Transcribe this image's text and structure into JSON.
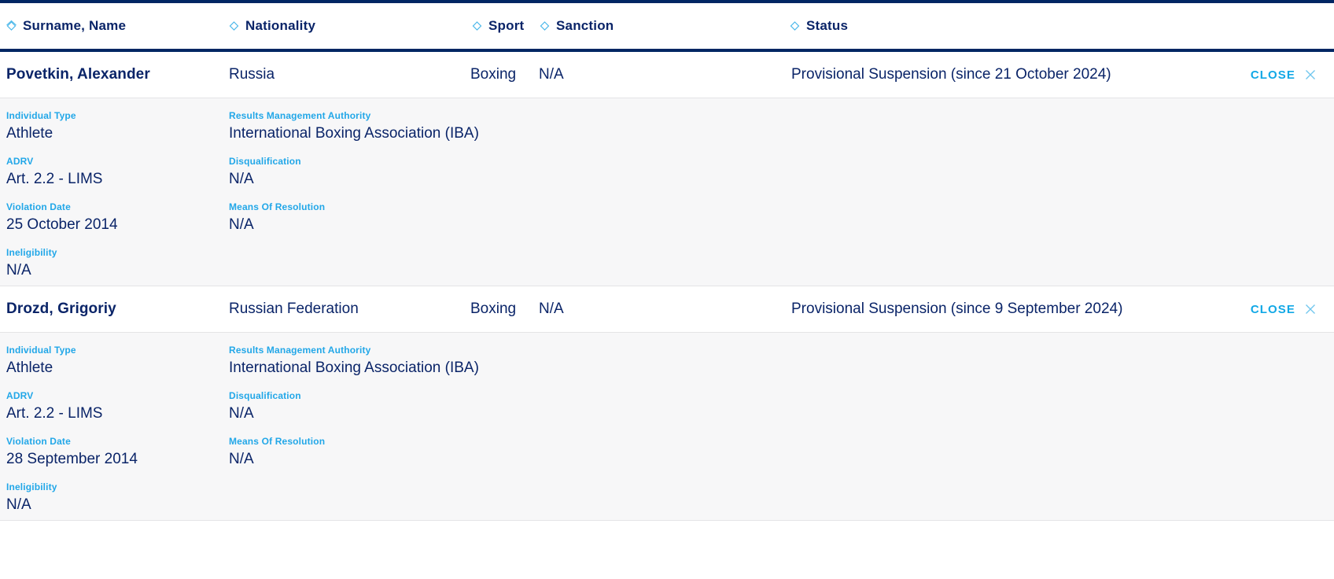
{
  "table": {
    "columns": [
      {
        "label": "Surname, Name",
        "sort_icon": "sort-diamond-icon"
      },
      {
        "label": "Nationality",
        "sort_icon": "sort-diamond-icon"
      },
      {
        "label": "Sport",
        "sort_icon": "sort-diamond-icon"
      },
      {
        "label": "Sanction",
        "sort_icon": "sort-diamond-icon"
      },
      {
        "label": "Status",
        "sort_icon": "sort-diamond-icon"
      }
    ],
    "close_label": "CLOSE",
    "close_icon": "close-x-icon",
    "rows": [
      {
        "name": "Povetkin, Alexander",
        "nationality": "Russia",
        "sport": "Boxing",
        "sanction": "N/A",
        "status": "Provisional Suspension (since 21 October 2024)",
        "details": {
          "individual_type": {
            "label": "Individual Type",
            "value": "Athlete"
          },
          "results_management_authority": {
            "label": "Results Management Authority",
            "value": "International Boxing Association (IBA)"
          },
          "adrv": {
            "label": "ADRV",
            "value": "Art. 2.2 - LIMS"
          },
          "disqualification": {
            "label": "Disqualification",
            "value": "N/A"
          },
          "violation_date": {
            "label": "Violation Date",
            "value": "25 October 2014"
          },
          "means_of_resolution": {
            "label": "Means Of Resolution",
            "value": "N/A"
          },
          "ineligibility": {
            "label": "Ineligibility",
            "value": "N/A"
          }
        }
      },
      {
        "name": "Drozd, Grigoriy",
        "nationality": "Russian Federation",
        "sport": "Boxing",
        "sanction": "N/A",
        "status": "Provisional Suspension (since 9 September 2024)",
        "details": {
          "individual_type": {
            "label": "Individual Type",
            "value": "Athlete"
          },
          "results_management_authority": {
            "label": "Results Management Authority",
            "value": "International Boxing Association (IBA)"
          },
          "adrv": {
            "label": "ADRV",
            "value": "Art. 2.2 - LIMS"
          },
          "disqualification": {
            "label": "Disqualification",
            "value": "N/A"
          },
          "violation_date": {
            "label": "Violation Date",
            "value": "28 September 2014"
          },
          "means_of_resolution": {
            "label": "Means Of Resolution",
            "value": "N/A"
          },
          "ineligibility": {
            "label": "Ineligibility",
            "value": "N/A"
          }
        }
      }
    ]
  },
  "colors": {
    "border_dark": "#002663",
    "text_dark": "#0a2468",
    "accent_cyan": "#22a7e8",
    "close_cyan": "#12a8e6",
    "panel_bg": "#f7f7f8",
    "divider": "#e4e4e6"
  }
}
